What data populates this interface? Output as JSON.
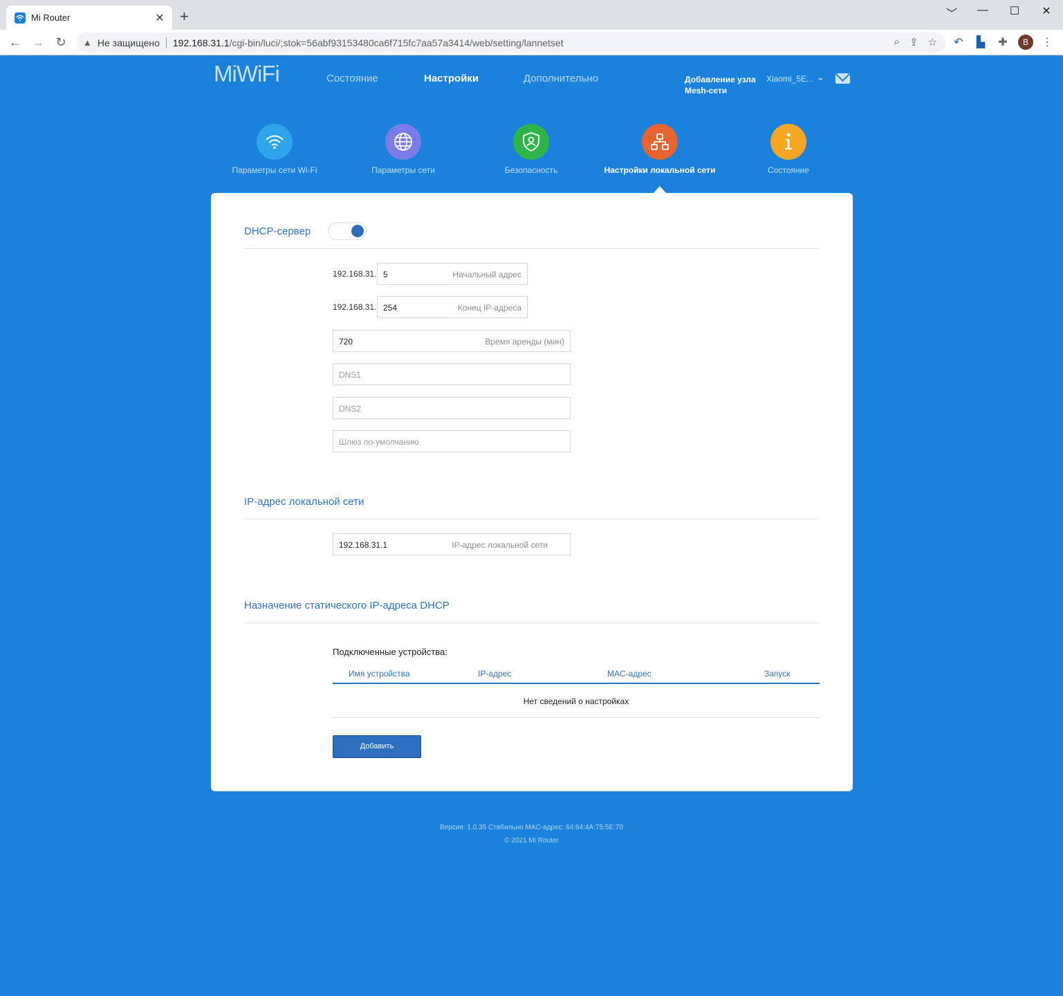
{
  "browser": {
    "tab_title": "Mi Router",
    "tab_close": "✕",
    "new_tab": "+",
    "window_controls": [
      "﹀",
      "—",
      "☐",
      "✕"
    ],
    "security_label": "Не защищено",
    "url_host": "192.168.31.1",
    "url_path": "/cgi-bin/luci/;stok=56abf93153480ca6f715fc7aa57a3414/web/setting/lannetset",
    "profile_initial": "B",
    "icons": [
      "zoom-icon",
      "share-icon",
      "star-icon",
      "back-arrow-icon",
      "bookmark-icon",
      "extensions-icon",
      "menu-icon"
    ]
  },
  "header": {
    "logo": "MiWiFi",
    "nav": [
      {
        "label": "Состояние",
        "active": false
      },
      {
        "label": "Настройки",
        "active": true
      },
      {
        "label": "Дополнительно",
        "active": false
      }
    ],
    "mesh_line1": "Добавление узла",
    "mesh_line2": "Mesh-сети",
    "device_name": "Xiaomi_5E..."
  },
  "categories": [
    {
      "label": "Параметры сети Wi-Fi",
      "color": "#2fa3ec",
      "icon": "wifi-icon"
    },
    {
      "label": "Параметры сети",
      "color": "#7b7bea",
      "icon": "globe-icon"
    },
    {
      "label": "Безопасность",
      "color": "#2fb44a",
      "icon": "shield-icon"
    },
    {
      "label": "Настройки локальной сети",
      "color": "#e8632e",
      "icon": "lan-topology-icon",
      "active": true
    },
    {
      "label": "Состояние",
      "color": "#f5a623",
      "icon": "info-icon"
    }
  ],
  "dhcp": {
    "title": "DHCP-сервер",
    "enabled": true,
    "prefix": "192.168.31.",
    "start_value": "5",
    "start_placeholder": "Начальный адрес",
    "end_value": "254",
    "end_placeholder": "Конец IP-адреса",
    "lease_value": "720",
    "lease_placeholder": "Время аренды (мин)",
    "dns1_placeholder": "DNS1",
    "dns2_placeholder": "DNS2",
    "gateway_placeholder": "Шлюз по-умолчанию"
  },
  "lan": {
    "title": "IP-адрес локальной сети",
    "ip_value": "192.168.31.1",
    "ip_placeholder": "IP-адрес локальной сети"
  },
  "static": {
    "title": "Назначение статического IP-адреса DHCP",
    "devices_label": "Подключенные устройства:",
    "columns": [
      "Имя устройства",
      "IP-адрес",
      "MAC-адрес",
      "Запуск"
    ],
    "empty_text": "Нет сведений о настройках",
    "add_button": "Добавить"
  },
  "footer": {
    "version_line": "Версия: 1.0.35 Стабильно  MAC-адрес: 64:64:4A:75:5E:70",
    "copyright": "© 2021 Mi Router"
  },
  "colors": {
    "page_bg": "#1a82dc",
    "accent": "#2d6fbf",
    "section_title": "#3072c0"
  }
}
